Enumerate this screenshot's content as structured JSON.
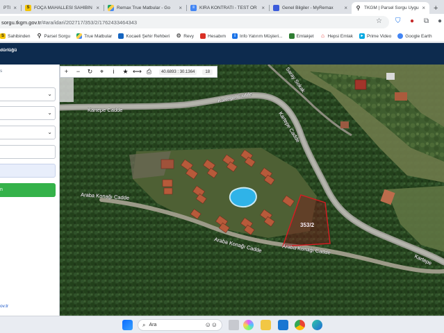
{
  "browser": {
    "tabs": [
      {
        "title": "PTI-",
        "favicon": "orange-square-icon",
        "active": false
      },
      {
        "title": "FOÇA MAHALLESİ SAHİBİN",
        "favicon": "sahibinden-icon",
        "active": false
      },
      {
        "title": "Remax True Matbular - Go",
        "favicon": "google-drive-icon",
        "active": false
      },
      {
        "title": "KİRA KONTRATI - TEST ÖR",
        "favicon": "docs-icon",
        "active": false
      },
      {
        "title": "Genel Bilgiler - MyRemax",
        "favicon": "remax-icon",
        "active": false
      },
      {
        "title": "TKGM | Parsel Sorgu Uygu",
        "favicon": "location-pin-icon",
        "active": true
      }
    ],
    "new_tab_glyph": "+",
    "address": {
      "host": "sorgu.tkgm.gov.tr",
      "path": "/#ara/idari/202717/353/2/1762433464343"
    },
    "bookmarks": [
      {
        "label": "Sahibinden",
        "icon": "sahibinden-icon",
        "color": "#f4c400",
        "glyph": "S"
      },
      {
        "label": "Parsel Sorgu",
        "icon": "location-pin-icon",
        "color": "#333333",
        "glyph": ""
      },
      {
        "label": "True Matbular",
        "icon": "google-drive-icon",
        "color": "#1fa463",
        "glyph": ""
      },
      {
        "label": "Kocaeli Şehir Rehberi",
        "icon": "city-guide-icon",
        "color": "#1565c0",
        "glyph": ""
      },
      {
        "label": "Revy",
        "icon": "gear-icon",
        "color": "#555555",
        "glyph": ""
      },
      {
        "label": "Hesabım",
        "icon": "account-icon",
        "color": "#d93025",
        "glyph": ""
      },
      {
        "label": "Info Yatırım Müşteri...",
        "icon": "info-icon",
        "color": "#1a73e8",
        "glyph": ""
      },
      {
        "label": "Emlakjet",
        "icon": "emlakjet-icon",
        "color": "#2e7d32",
        "glyph": ""
      },
      {
        "label": "Hepsi Emlak",
        "icon": "hepsiemlak-icon",
        "color": "#e53935",
        "glyph": ""
      },
      {
        "label": "Prime Video",
        "icon": "prime-video-icon",
        "color": "#00a8e1",
        "glyph": ""
      },
      {
        "label": "Google Earth",
        "icon": "google-earth-icon",
        "color": "#4285f4",
        "glyph": ""
      }
    ]
  },
  "app": {
    "header_text": "dürlüğü",
    "left_panel": {
      "heading": "s",
      "footer_link": "ov.tr",
      "button_text": "n"
    },
    "map_toolbar": {
      "coords": "40.6893 : 30.1364",
      "zoom": "18"
    },
    "map_labels": {
      "road_top": "Kartepe Cadde",
      "road_diag": "Kartepe Cadde",
      "road_soka": "Saray Sokak",
      "road_araba1": "Araba Konağı Cadde",
      "road_araba2": "Araba Konağı Cadde",
      "road_araba3": "Araba Konağı Cadde",
      "road_right": "Kartepe",
      "parcel": "353/2"
    },
    "parcel_color": "#d81b22"
  },
  "taskbar": {
    "search_text": "Ara"
  }
}
